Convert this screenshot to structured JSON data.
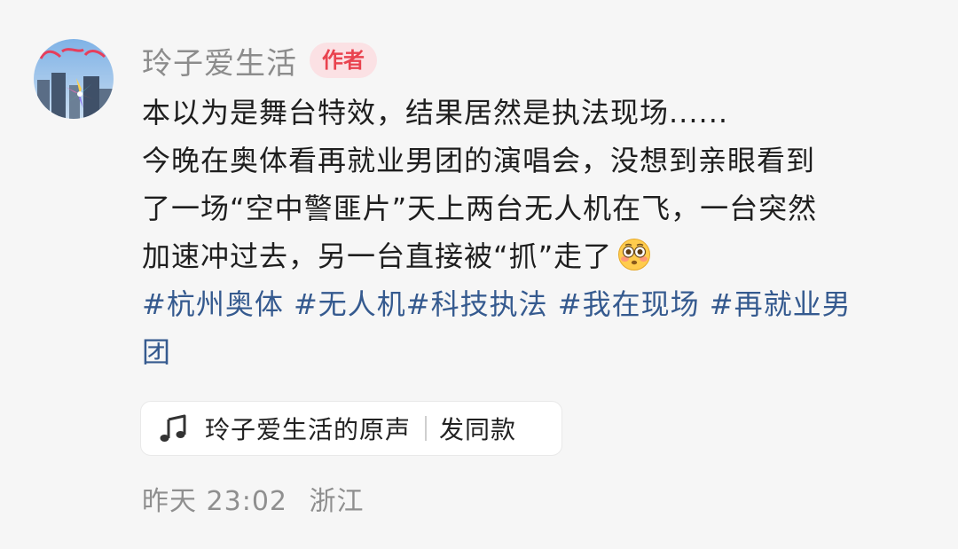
{
  "post": {
    "author": "玲子爱生活",
    "author_badge": "作者",
    "lines": [
      "本以为是舞台特效，结果居然是执法现场......",
      "今晚在奥体看再就业男团的演唱会，没想到亲眼看到",
      "了一场“空中警匪片”天上两台无人机在飞，一台突然",
      "加速冲过去，另一台直接被“抓”走了"
    ],
    "emoji": "flushed-face-icon",
    "hashtags_line1": "#杭州奥体 #无人机#科技执法 #我在现场 #再就业男",
    "hashtags_line2": "团",
    "sound": {
      "icon": "music-note-icon",
      "title": "玲子爱生活的原声",
      "action": "发同款"
    },
    "meta": {
      "time": "昨天 23:02",
      "location": "浙江"
    }
  },
  "colors": {
    "background": "#f6f6f6",
    "hashtag": "#355a8f",
    "badge_text": "#e9434f",
    "badge_bg": "#fbe1e4",
    "muted": "#8f8f8f"
  }
}
